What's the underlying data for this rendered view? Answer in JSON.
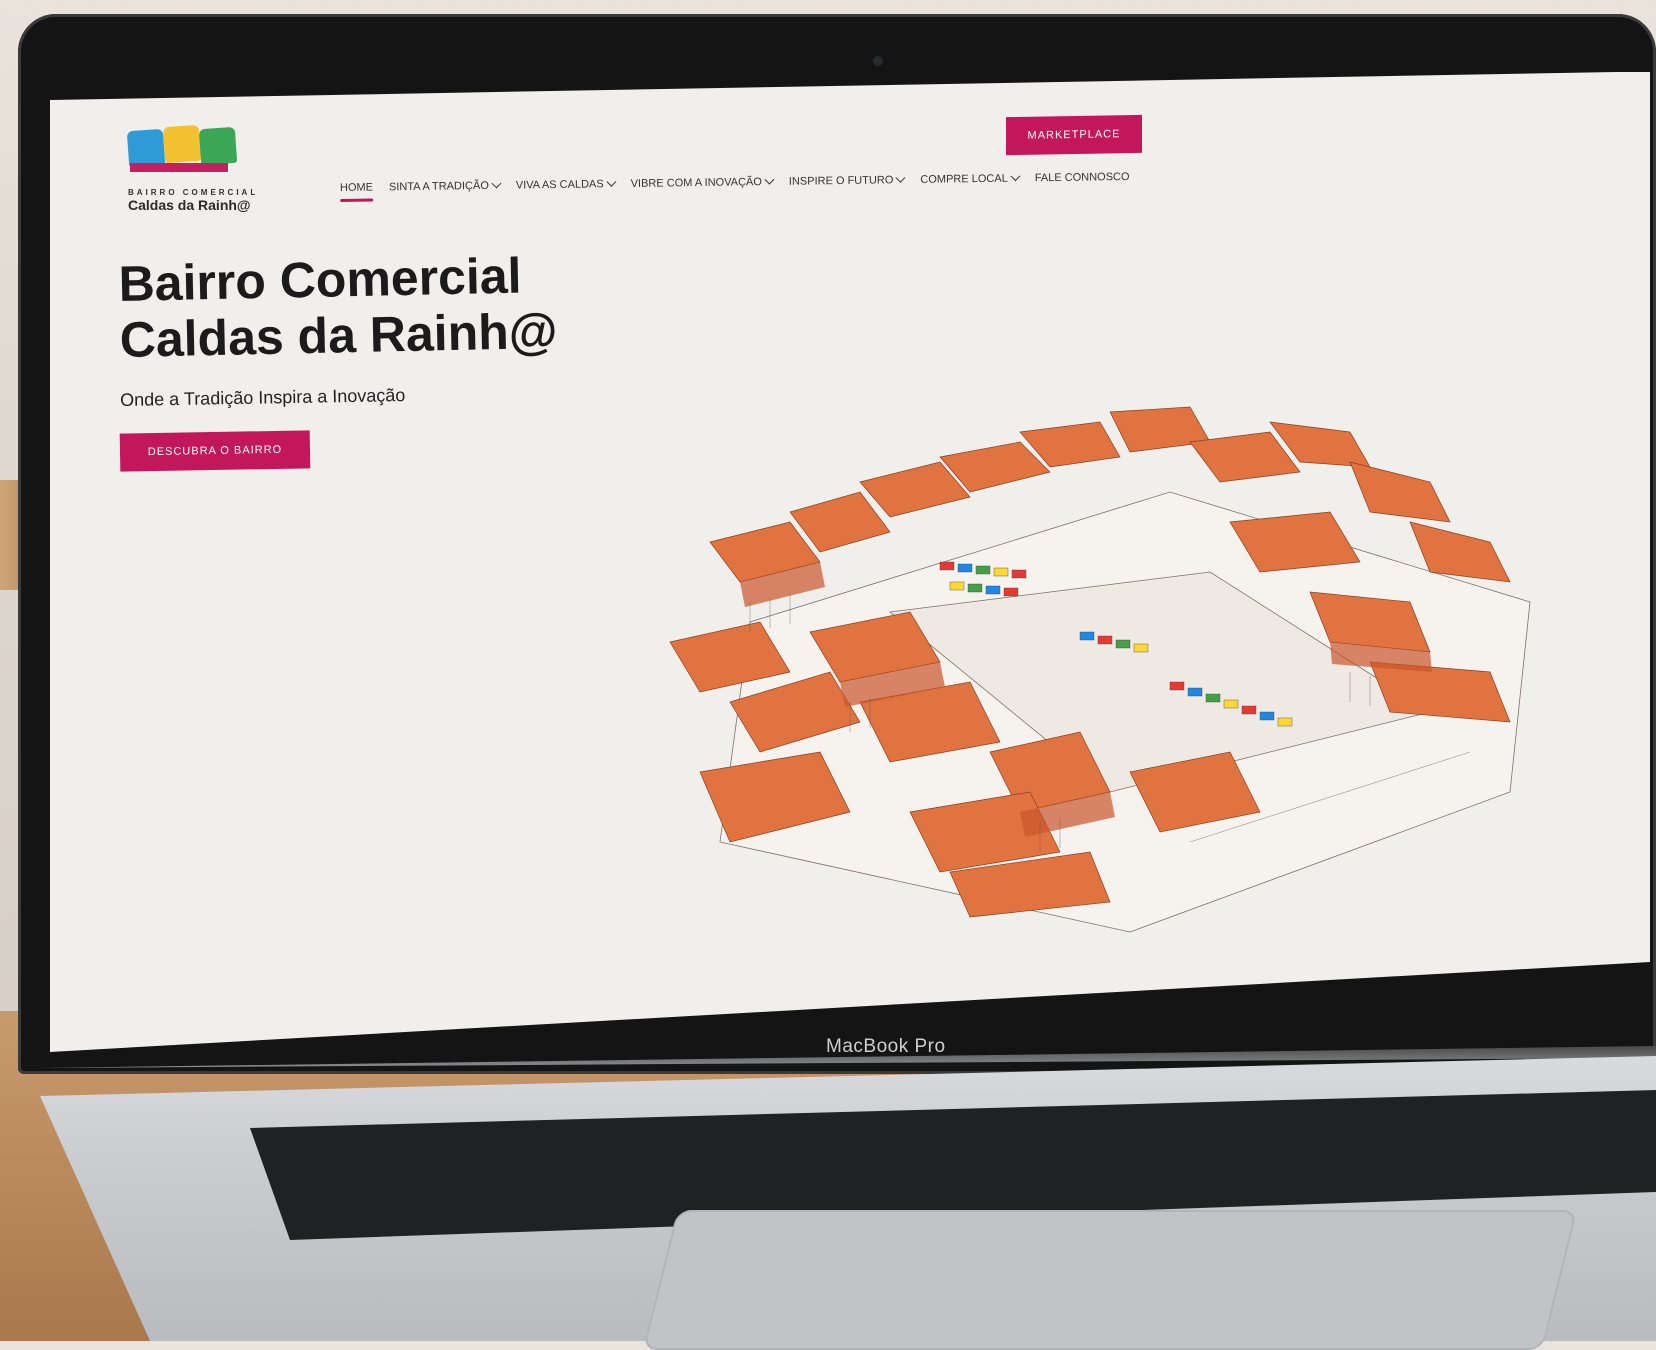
{
  "logo": {
    "small_text": "BAIRRO COMERCIAL",
    "name": "Caldas da Rainh@",
    "colors": [
      "#2f9bd6",
      "#f2c231",
      "#3aa656",
      "#c41f5e"
    ]
  },
  "header": {
    "marketplace_label": "MARKETPLACE"
  },
  "nav": {
    "items": [
      {
        "label": "HOME",
        "active": true,
        "dropdown": false
      },
      {
        "label": "SINTA A TRADIÇÃO",
        "active": false,
        "dropdown": true
      },
      {
        "label": "VIVA AS CALDAS",
        "active": false,
        "dropdown": true
      },
      {
        "label": "VIBRE COM A INOVAÇÃO",
        "active": false,
        "dropdown": true
      },
      {
        "label": "INSPIRE O FUTURO",
        "active": false,
        "dropdown": true
      },
      {
        "label": "COMPRE LOCAL",
        "active": false,
        "dropdown": true
      },
      {
        "label": "FALE CONNOSCO",
        "active": false,
        "dropdown": false
      }
    ]
  },
  "hero": {
    "title_line1": "Bairro Comercial",
    "title_line2": "Caldas da Rainh@",
    "subtitle": "Onde a Tradição Inspira a Inovação",
    "cta_label": "DESCUBRA O BAIRRO"
  },
  "device": {
    "label": "MacBook Pro"
  },
  "theme": {
    "accent": "#c2185b",
    "roof": "#e0733f",
    "roof_dark": "#c9562b"
  }
}
